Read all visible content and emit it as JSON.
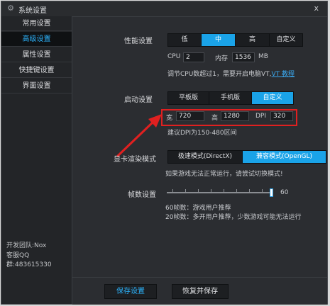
{
  "window": {
    "title": "系统设置",
    "close": "x"
  },
  "sidebar": {
    "items": [
      {
        "label": "常用设置"
      },
      {
        "label": "高级设置"
      },
      {
        "label": "属性设置"
      },
      {
        "label": "快捷键设置"
      },
      {
        "label": "界面设置"
      }
    ],
    "credits": {
      "team": "开发团队:Nox",
      "qq": "客服QQ群:483615330"
    }
  },
  "performance": {
    "label": "性能设置",
    "options": [
      "低",
      "中",
      "高",
      "自定义"
    ],
    "selected": "中",
    "cpu_label": "CPU",
    "cpu_value": "2",
    "mem_label": "内存",
    "mem_value": "1536",
    "mem_unit": "MB",
    "hint": "调节CPU数超过1，需要开启电脑VT,",
    "hint_link": "VT 教程"
  },
  "startup": {
    "label": "启动设置",
    "options": [
      "平板版",
      "手机版",
      "自定义"
    ],
    "selected": "自定义",
    "width_label": "宽",
    "width_value": "720",
    "height_label": "高",
    "height_value": "1280",
    "dpi_label": "DPI",
    "dpi_value": "320",
    "hint": "建议DPI为150-480区间"
  },
  "render": {
    "label": "显卡渲染模式",
    "options": [
      "极速模式(DirectX)",
      "兼容模式(OpenGL)"
    ],
    "selected": "兼容模式(OpenGL)",
    "hint": "如果游戏无法正常运行，请尝试切换模式!"
  },
  "fps": {
    "label": "帧数设置",
    "value": "60",
    "fraction": 1.0,
    "hint1": "60帧数：游戏用户推荐",
    "hint2": "20帧数：多开用户推荐，少数游戏可能无法运行"
  },
  "footer": {
    "save": "保存设置",
    "restore": "恢复并保存"
  },
  "colors": {
    "accent": "#1aa3e8",
    "highlight_box": "#e02020",
    "background": "#2b2d31"
  }
}
